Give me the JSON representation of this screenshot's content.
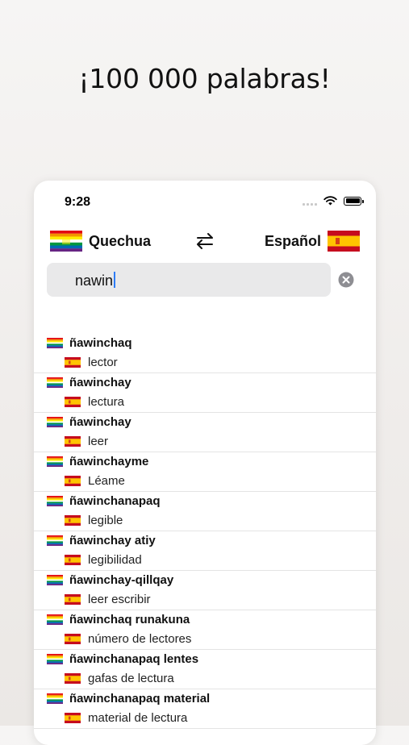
{
  "headline": "¡100 000 palabras!",
  "status_bar": {
    "time": "9:28"
  },
  "languages": {
    "source": {
      "name": "Quechua",
      "flag": "wiphala-flag-icon"
    },
    "target": {
      "name": "Español",
      "flag": "spain-flag-icon"
    },
    "swap_icon": "swap-arrows-icon"
  },
  "search": {
    "value": "nawin",
    "clear_icon": "clear-circle-icon"
  },
  "results": [
    {
      "quechua": "ñawinchaq",
      "spanish": "lector"
    },
    {
      "quechua": "ñawinchay",
      "spanish": "lectura"
    },
    {
      "quechua": "ñawinchay",
      "spanish": "leer"
    },
    {
      "quechua": "ñawinchayme",
      "spanish": "Léame"
    },
    {
      "quechua": "ñawinchanapaq",
      "spanish": "legible"
    },
    {
      "quechua": "ñawinchay atiy",
      "spanish": "legibilidad"
    },
    {
      "quechua": "ñawinchay-qillqay",
      "spanish": "leer escribir"
    },
    {
      "quechua": "ñawinchaq runakuna",
      "spanish": "número de lectores"
    },
    {
      "quechua": "ñawinchanapaq lentes",
      "spanish": "gafas de lectura"
    },
    {
      "quechua": "ñawinchanapaq material",
      "spanish": "material de lectura"
    }
  ],
  "colors": {
    "caret": "#2d7cf6",
    "search_bg": "#e9e9ea",
    "spain_red": "#c60b1e",
    "spain_yellow": "#ffc400"
  }
}
